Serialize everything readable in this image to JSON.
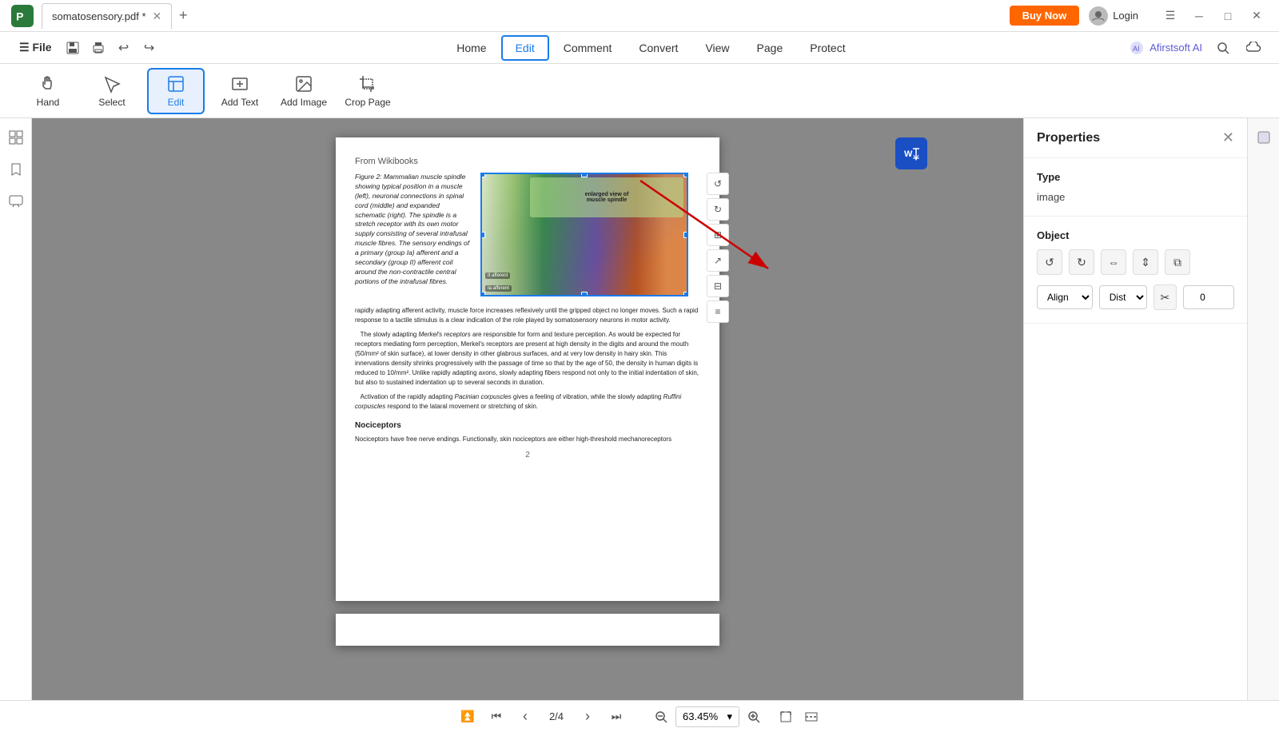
{
  "app": {
    "title": "somatosensory.pdf *",
    "buy_now": "Buy Now",
    "login": "Login"
  },
  "title_bar": {
    "file_menu": "File",
    "undo_tooltip": "Undo",
    "redo_tooltip": "Redo",
    "save_tooltip": "Save"
  },
  "menu": {
    "items": [
      {
        "label": "Home",
        "id": "home",
        "active": false
      },
      {
        "label": "Edit",
        "id": "edit",
        "active": true
      },
      {
        "label": "Comment",
        "id": "comment",
        "active": false
      },
      {
        "label": "Convert",
        "id": "convert",
        "active": false
      },
      {
        "label": "View",
        "id": "view",
        "active": false
      },
      {
        "label": "Page",
        "id": "page",
        "active": false
      },
      {
        "label": "Protect",
        "id": "protect",
        "active": false
      }
    ],
    "ai_label": "Afirstsoft AI",
    "search_tooltip": "Search"
  },
  "toolbar": {
    "tools": [
      {
        "id": "hand",
        "label": "Hand",
        "active": false
      },
      {
        "id": "select",
        "label": "Select",
        "active": false
      },
      {
        "id": "edit",
        "label": "Edit",
        "active": true
      },
      {
        "id": "add-text",
        "label": "Add Text",
        "active": false
      },
      {
        "id": "add-image",
        "label": "Add Image",
        "active": false
      },
      {
        "id": "crop-page",
        "label": "Crop Page",
        "active": false
      }
    ]
  },
  "properties_panel": {
    "title": "Properties",
    "type_label": "Type",
    "type_value": "image",
    "object_label": "Object",
    "rotation_value": "0"
  },
  "document": {
    "from_label": "From Wikibooks",
    "figure_caption": "Figure 2: Mammalian muscle spindle showing typical position in a muscle (left), neuronal connections in spinal cord (middle) and expanded schematic (right). The spindle is a stretch receptor with its own motor supply consisting of several intrafusal muscle fibres. The sensory endings of a primary (group Ia) afferent and a secondary (group II) afferent coil around the non-contractile central portions of the intrafusal fibres.",
    "body_paragraphs": [
      "rapidly adapting afferent activity, muscle force increases reflexively until the gripped object no longer moves. Such a rapid response to a tactile stimulus is a clear indication of the role played by somatosensory neurons in motor activity.",
      "The slowly adapting Merkel's receptors are responsible for form and texture perception. As would be expected for receptors mediating form perception, Merkel's receptors are present at high density in the digits and around the mouth (50/mm² of skin surface), at lower density in other glabrous surfaces, and at very low density in hairy skin. This innervations density shrinks progressively with the passage of time so that by the age of 50, the density in human digits is reduced to 10/mm². Unlike rapidly adapting axons, slowly adapting fibers respond not only to the initial indentation of skin, but also to sustained indentation up to several seconds in duration.",
      "Activation of the rapidly adapting Pacinian corpuscles gives a feeling of vibration, while the slowly adapting Ruffini corpuscles respond to the lataral movement or stretching of skin."
    ],
    "section_nociceptors": "Nociceptors",
    "nociceptors_text": "Nociceptors have free nerve endings. Functionally, skin nociceptors are either high-threshold mechanoreceptors",
    "page_number": "2"
  },
  "bottom_bar": {
    "page_indicator": "2/4",
    "zoom_level": "63.45%",
    "nav_first": "⏫",
    "nav_prev_page": "⏮",
    "nav_prev": "‹",
    "nav_next": "›",
    "nav_next_page": "⏭",
    "zoom_in": "+",
    "zoom_out": "-"
  }
}
